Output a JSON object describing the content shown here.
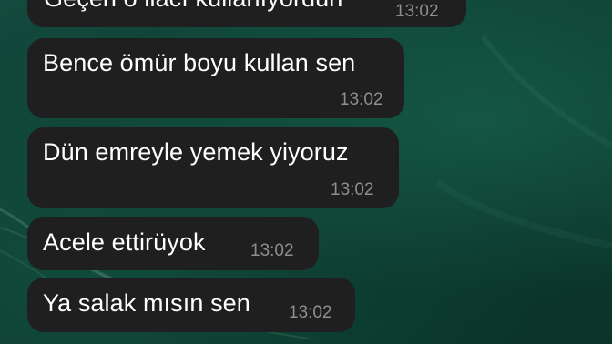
{
  "chat": {
    "messages": [
      {
        "text": "Geçen o ilacı kullanıyordun",
        "time": "13:02"
      },
      {
        "text": "Bence ömür boyu kullan sen",
        "time": "13:02"
      },
      {
        "text": "Dün emreyle yemek yiyoruz",
        "time": "13:02"
      },
      {
        "text": "Acele ettirüyok",
        "time": "13:02"
      },
      {
        "text": "Ya salak mısın sen",
        "time": "13:02"
      }
    ]
  },
  "colors": {
    "bubble": "#1f1f1f",
    "text": "#ffffff",
    "timestamp": "#8e8e8e",
    "wallpaper": "#0e4134"
  }
}
